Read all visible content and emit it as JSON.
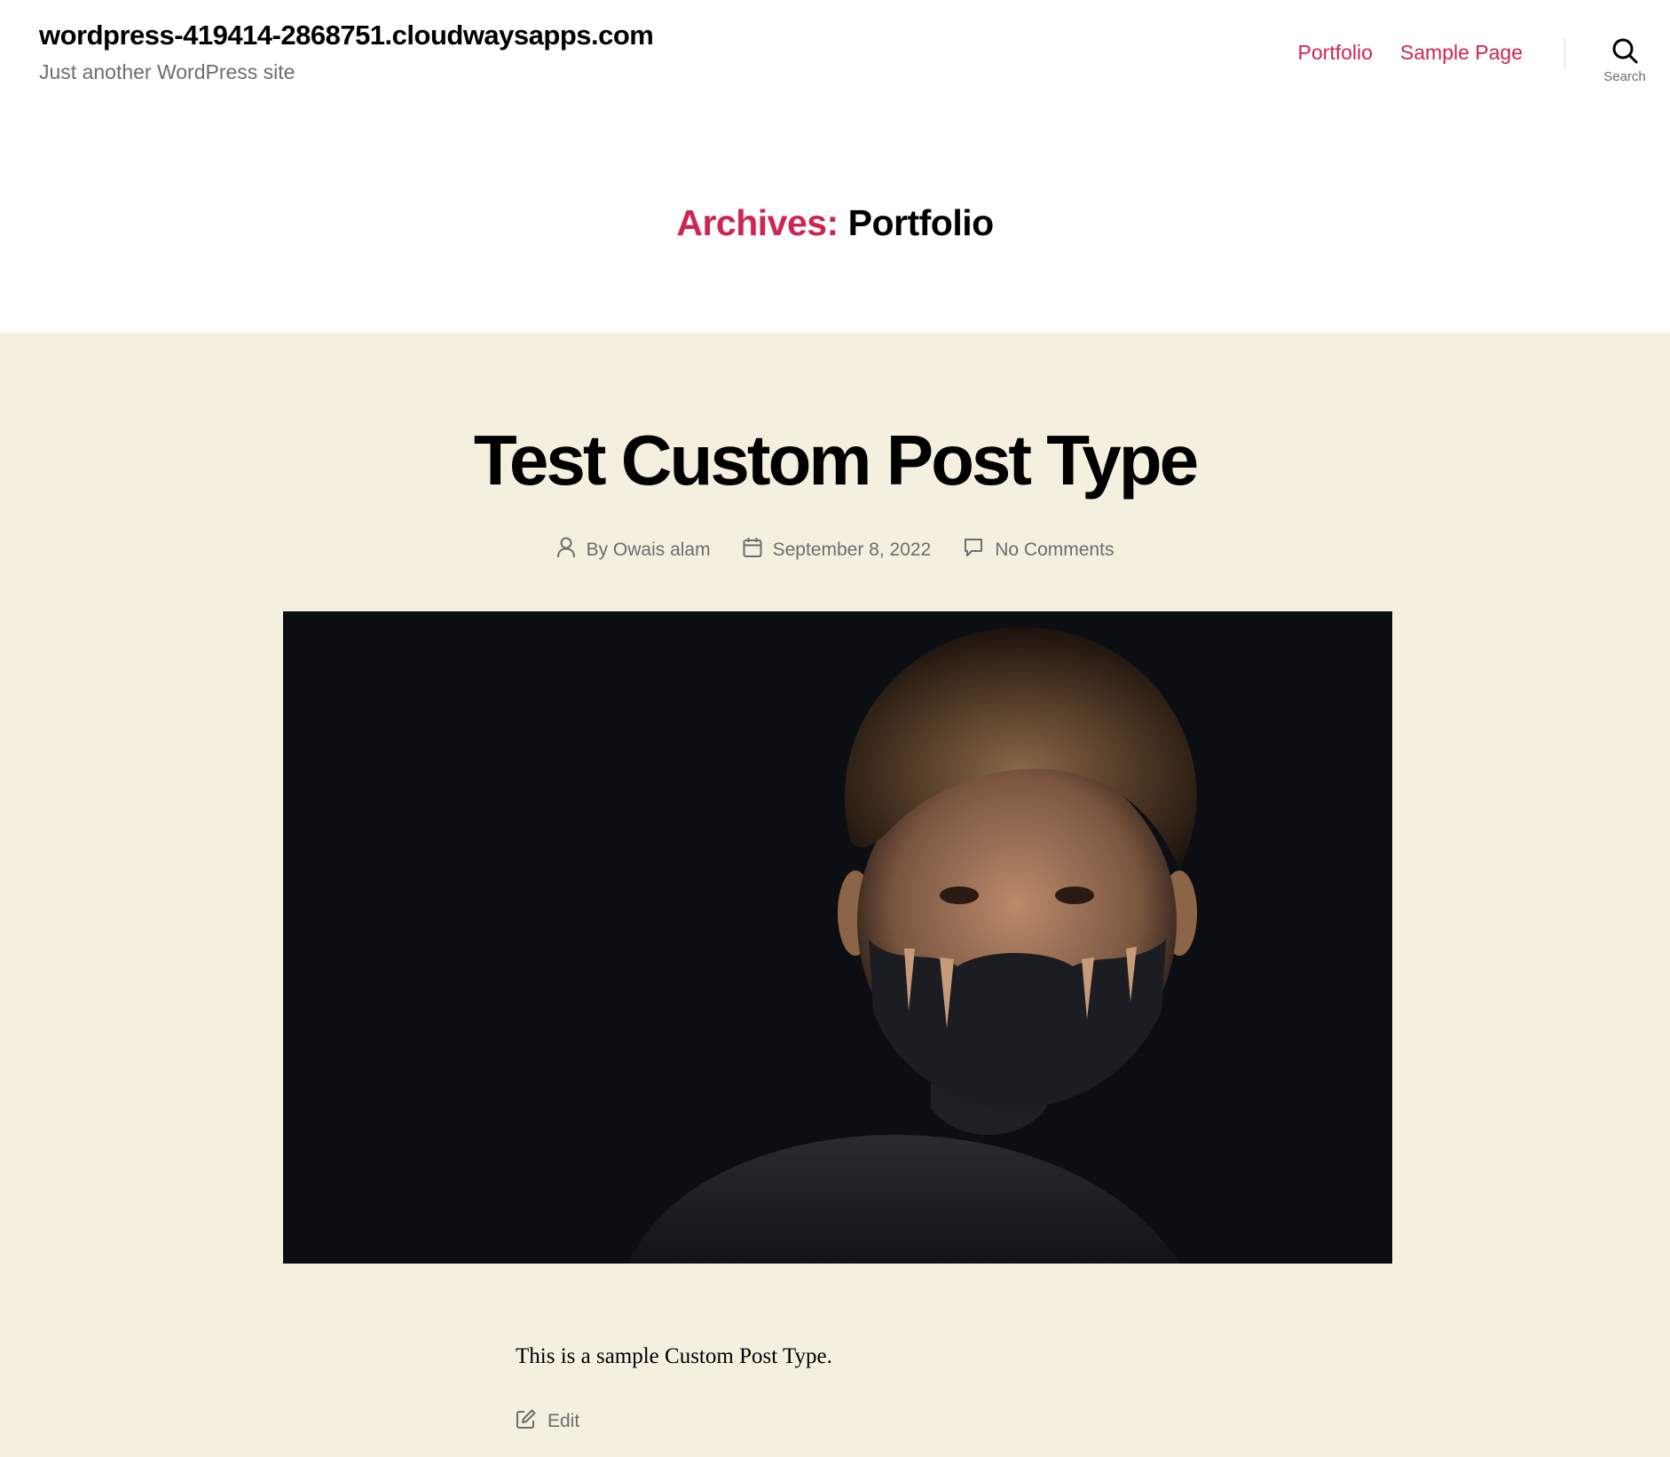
{
  "header": {
    "site_title": "wordpress-419414-2868751.cloudwaysapps.com",
    "site_description": "Just another WordPress site",
    "nav": [
      {
        "label": "Portfolio"
      },
      {
        "label": "Sample Page"
      }
    ],
    "search_label": "Search",
    "accent_color": "#cd2653"
  },
  "archive": {
    "prefix": "Archives:",
    "name": "Portfolio"
  },
  "post": {
    "title": "Test Custom Post Type",
    "author": "By Owais alam",
    "date": "September 8, 2022",
    "comments": "No Comments",
    "content": "This is a sample Custom Post Type.",
    "edit_label": "Edit",
    "background_color": "#f5efe0"
  },
  "icons": {
    "search": "search-icon",
    "author": "user-icon",
    "date": "calendar-icon",
    "comments": "comment-icon",
    "edit": "edit-icon"
  }
}
